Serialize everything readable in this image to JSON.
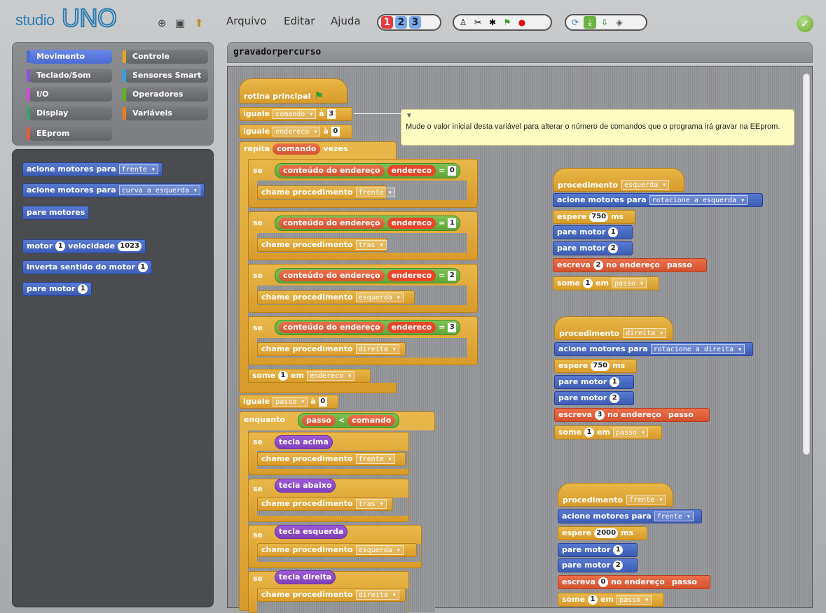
{
  "app": {
    "logo": "studio",
    "logo_uno": "UNO"
  },
  "menu": {
    "file": "Arquivo",
    "edit": "Editar",
    "help": "Ajuda"
  },
  "views": [
    "1",
    "2",
    "3"
  ],
  "categories": [
    {
      "label": "Movimento",
      "color": "#4a6cd4"
    },
    {
      "label": "Controle",
      "color": "#e1a91a"
    },
    {
      "label": "Teclado/Som",
      "color": "#8a55d7"
    },
    {
      "label": "Sensores Smart",
      "color": "#2ca5e2"
    },
    {
      "label": "I/O",
      "color": "#cf4ad9"
    },
    {
      "label": "Operadores",
      "color": "#5cb712"
    },
    {
      "label": "Display",
      "color": "#3aa06d"
    },
    {
      "label": "Variáveis",
      "color": "#ee7d16"
    },
    {
      "label": "EEprom",
      "color": "#e55c3c"
    }
  ],
  "palette": {
    "b1": "acione motores para",
    "b1v": "frente",
    "b2": "acione motores para",
    "b2v": "curva a esquerda",
    "b3": "pare motores",
    "b4": "motor",
    "b4v": "1",
    "b4b": "velocidade",
    "b4n": "1023",
    "b5": "inverta sentido do motor",
    "b5v": "1",
    "b6": "pare motor",
    "b6v": "1"
  },
  "script": {
    "title": "gravadorpercurso",
    "main": "rotina principal",
    "set": "iguale",
    "to": "à",
    "var_comando": "comando",
    "var_endereco": "endereco",
    "var_passo": "passo",
    "v3": "3",
    "v0": "0",
    "repeat": "repita",
    "times": "vezes",
    "if": "se",
    "content": "conteúdo do endereço",
    "eq": "=",
    "call": "chame procedimento",
    "p_frente": "frente",
    "p_tras": "tras",
    "p_esquerda": "esquerda",
    "p_direita": "direita",
    "n0": "0",
    "n1": "1",
    "n2": "2",
    "n3": "3",
    "add": "some",
    "in": "em",
    "while": "enquanto",
    "lt": "<",
    "k_up": "tecla acima",
    "k_down": "tecla abaixo",
    "k_left": "tecla esquerda",
    "k_right": "tecla direita",
    "comment": "Mude o valor inicial desta variável para alterar o número de comandos que o programa irá gravar na EEprom."
  },
  "procs": {
    "proc": "procedimento",
    "motors": "acione motores para",
    "wait": "espere",
    "ms": "ms",
    "stop": "pare motor",
    "write": "escreva",
    "at_addr": "no endereço",
    "rot_left": "rotacione a esquerda",
    "rot_right": "rotacione a direita",
    "w750": "750",
    "w2000": "2000",
    "m1": "1",
    "m2": "2",
    "w2": "2",
    "w3": "3",
    "w0": "0"
  }
}
